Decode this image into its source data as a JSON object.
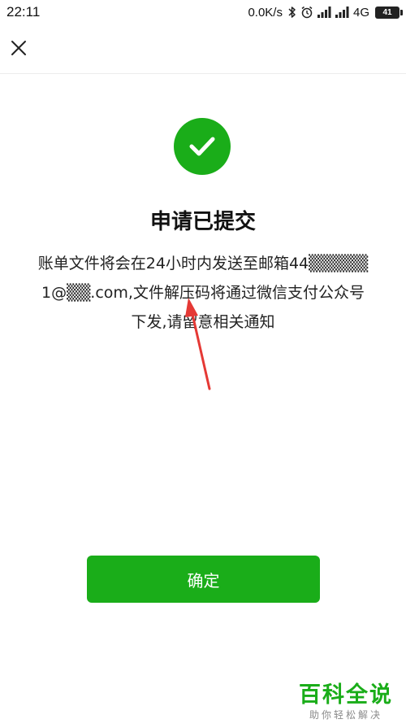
{
  "status_bar": {
    "time": "22:11",
    "speed": "0.0K/s",
    "network": "4G",
    "battery_level": "41",
    "icons": [
      "bluetooth-icon",
      "alarm-icon",
      "signal-icon",
      "signal-icon",
      "battery-icon"
    ]
  },
  "nav": {
    "close_icon": "close-icon"
  },
  "result": {
    "icon": "success-check-icon",
    "title": "申请已提交",
    "message_lines": [
      "账单文件将会在24小时内发送至邮箱44▒▒▒▒▒",
      "1@▒▒.com,文件解压码将通过微信支付公众号",
      "下发,请留意相关通知"
    ]
  },
  "actions": {
    "confirm_label": "确定"
  },
  "watermark": {
    "main": "百科全说",
    "sub": "助你轻松解决"
  },
  "colors": {
    "accent": "#1aad19",
    "annotation_arrow": "#e53935",
    "text": "#111111",
    "background": "#ffffff"
  }
}
